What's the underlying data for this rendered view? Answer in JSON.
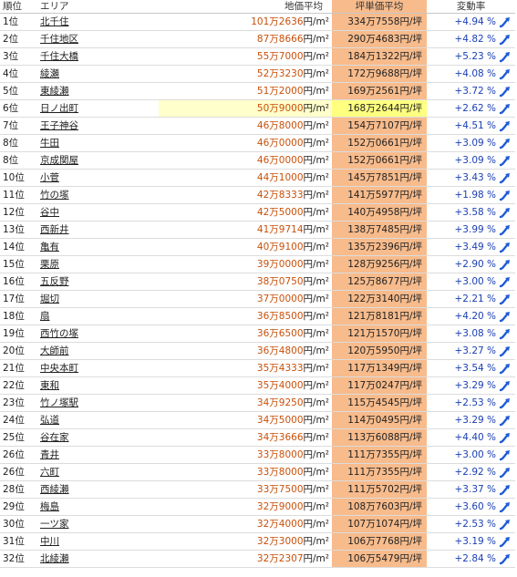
{
  "header": {
    "rank": "順位",
    "area": "エリア",
    "price_avg": "地価平均",
    "tsubo_avg": "坪単価平均",
    "change_rate": "変動率"
  },
  "colors": {
    "price_number": "#c8500a",
    "tsubo_bg": "#f7bb8c",
    "highlight_bg": "#ffff80",
    "change_text": "#1a3fb4"
  },
  "rows": [
    {
      "rank": "1位",
      "area": "北千住",
      "price": "101万2636",
      "price_unit": "円/m²",
      "tsubo": "334万7558円/坪",
      "change": "+4.94 %",
      "highlight": false
    },
    {
      "rank": "2位",
      "area": "千住地区",
      "price": "87万8666",
      "price_unit": "円/m²",
      "tsubo": "290万4683円/坪",
      "change": "+4.82 %",
      "highlight": false
    },
    {
      "rank": "3位",
      "area": "千住大橋",
      "price": "55万7000",
      "price_unit": "円/m²",
      "tsubo": "184万1322円/坪",
      "change": "+5.23 %",
      "highlight": false
    },
    {
      "rank": "4位",
      "area": "綾瀬",
      "price": "52万3230",
      "price_unit": "円/m²",
      "tsubo": "172万9688円/坪",
      "change": "+4.08 %",
      "highlight": false
    },
    {
      "rank": "5位",
      "area": "東綾瀬",
      "price": "51万2000",
      "price_unit": "円/m²",
      "tsubo": "169万2561円/坪",
      "change": "+3.72 %",
      "highlight": false
    },
    {
      "rank": "6位",
      "area": "日ノ出町",
      "price": "50万9000",
      "price_unit": "円/m²",
      "tsubo": "168万2644円/坪",
      "change": "+2.62 %",
      "highlight": true
    },
    {
      "rank": "7位",
      "area": "王子神谷",
      "price": "46万8000",
      "price_unit": "円/m²",
      "tsubo": "154万7107円/坪",
      "change": "+4.51 %",
      "highlight": false
    },
    {
      "rank": "8位",
      "area": "牛田",
      "price": "46万0000",
      "price_unit": "円/m²",
      "tsubo": "152万0661円/坪",
      "change": "+3.09 %",
      "highlight": false
    },
    {
      "rank": "8位",
      "area": "京成関屋",
      "price": "46万0000",
      "price_unit": "円/m²",
      "tsubo": "152万0661円/坪",
      "change": "+3.09 %",
      "highlight": false
    },
    {
      "rank": "10位",
      "area": "小菅",
      "price": "44万1000",
      "price_unit": "円/m²",
      "tsubo": "145万7851円/坪",
      "change": "+3.43 %",
      "highlight": false
    },
    {
      "rank": "11位",
      "area": "竹の塚",
      "price": "42万8333",
      "price_unit": "円/m²",
      "tsubo": "141万5977円/坪",
      "change": "+1.98 %",
      "highlight": false
    },
    {
      "rank": "12位",
      "area": "谷中",
      "price": "42万5000",
      "price_unit": "円/m²",
      "tsubo": "140万4958円/坪",
      "change": "+3.58 %",
      "highlight": false
    },
    {
      "rank": "13位",
      "area": "西新井",
      "price": "41万9714",
      "price_unit": "円/m²",
      "tsubo": "138万7485円/坪",
      "change": "+3.99 %",
      "highlight": false
    },
    {
      "rank": "14位",
      "area": "亀有",
      "price": "40万9100",
      "price_unit": "円/m²",
      "tsubo": "135万2396円/坪",
      "change": "+3.49 %",
      "highlight": false
    },
    {
      "rank": "15位",
      "area": "栗原",
      "price": "39万0000",
      "price_unit": "円/m²",
      "tsubo": "128万9256円/坪",
      "change": "+2.90 %",
      "highlight": false
    },
    {
      "rank": "16位",
      "area": "五反野",
      "price": "38万0750",
      "price_unit": "円/m²",
      "tsubo": "125万8677円/坪",
      "change": "+3.00 %",
      "highlight": false
    },
    {
      "rank": "17位",
      "area": "堀切",
      "price": "37万0000",
      "price_unit": "円/m²",
      "tsubo": "122万3140円/坪",
      "change": "+2.21 %",
      "highlight": false
    },
    {
      "rank": "18位",
      "area": "扇",
      "price": "36万8500",
      "price_unit": "円/m²",
      "tsubo": "121万8181円/坪",
      "change": "+4.20 %",
      "highlight": false
    },
    {
      "rank": "19位",
      "area": "西竹の塚",
      "price": "36万6500",
      "price_unit": "円/m²",
      "tsubo": "121万1570円/坪",
      "change": "+3.08 %",
      "highlight": false
    },
    {
      "rank": "20位",
      "area": "大師前",
      "price": "36万4800",
      "price_unit": "円/m²",
      "tsubo": "120万5950円/坪",
      "change": "+3.27 %",
      "highlight": false
    },
    {
      "rank": "21位",
      "area": "中央本町",
      "price": "35万4333",
      "price_unit": "円/m²",
      "tsubo": "117万1349円/坪",
      "change": "+3.54 %",
      "highlight": false
    },
    {
      "rank": "22位",
      "area": "東和",
      "price": "35万4000",
      "price_unit": "円/m²",
      "tsubo": "117万0247円/坪",
      "change": "+3.29 %",
      "highlight": false
    },
    {
      "rank": "23位",
      "area": "竹ノ塚駅",
      "price": "34万9250",
      "price_unit": "円/m²",
      "tsubo": "115万4545円/坪",
      "change": "+2.53 %",
      "highlight": false
    },
    {
      "rank": "24位",
      "area": "弘道",
      "price": "34万5000",
      "price_unit": "円/m²",
      "tsubo": "114万0495円/坪",
      "change": "+3.29 %",
      "highlight": false
    },
    {
      "rank": "25位",
      "area": "谷在家",
      "price": "34万3666",
      "price_unit": "円/m²",
      "tsubo": "113万6088円/坪",
      "change": "+4.40 %",
      "highlight": false
    },
    {
      "rank": "26位",
      "area": "青井",
      "price": "33万8000",
      "price_unit": "円/m²",
      "tsubo": "111万7355円/坪",
      "change": "+3.00 %",
      "highlight": false
    },
    {
      "rank": "26位",
      "area": "六町",
      "price": "33万8000",
      "price_unit": "円/m²",
      "tsubo": "111万7355円/坪",
      "change": "+2.92 %",
      "highlight": false
    },
    {
      "rank": "28位",
      "area": "西綾瀬",
      "price": "33万7500",
      "price_unit": "円/m²",
      "tsubo": "111万5702円/坪",
      "change": "+3.37 %",
      "highlight": false
    },
    {
      "rank": "29位",
      "area": "梅島",
      "price": "32万9000",
      "price_unit": "円/m²",
      "tsubo": "108万7603円/坪",
      "change": "+3.60 %",
      "highlight": false
    },
    {
      "rank": "30位",
      "area": "一ツ家",
      "price": "32万4000",
      "price_unit": "円/m²",
      "tsubo": "107万1074円/坪",
      "change": "+2.53 %",
      "highlight": false
    },
    {
      "rank": "31位",
      "area": "中川",
      "price": "32万3000",
      "price_unit": "円/m²",
      "tsubo": "106万7768円/坪",
      "change": "+3.19 %",
      "highlight": false
    },
    {
      "rank": "32位",
      "area": "北綾瀬",
      "price": "32万2307",
      "price_unit": "円/m²",
      "tsubo": "106万5479円/坪",
      "change": "+2.84 %",
      "highlight": false
    }
  ]
}
